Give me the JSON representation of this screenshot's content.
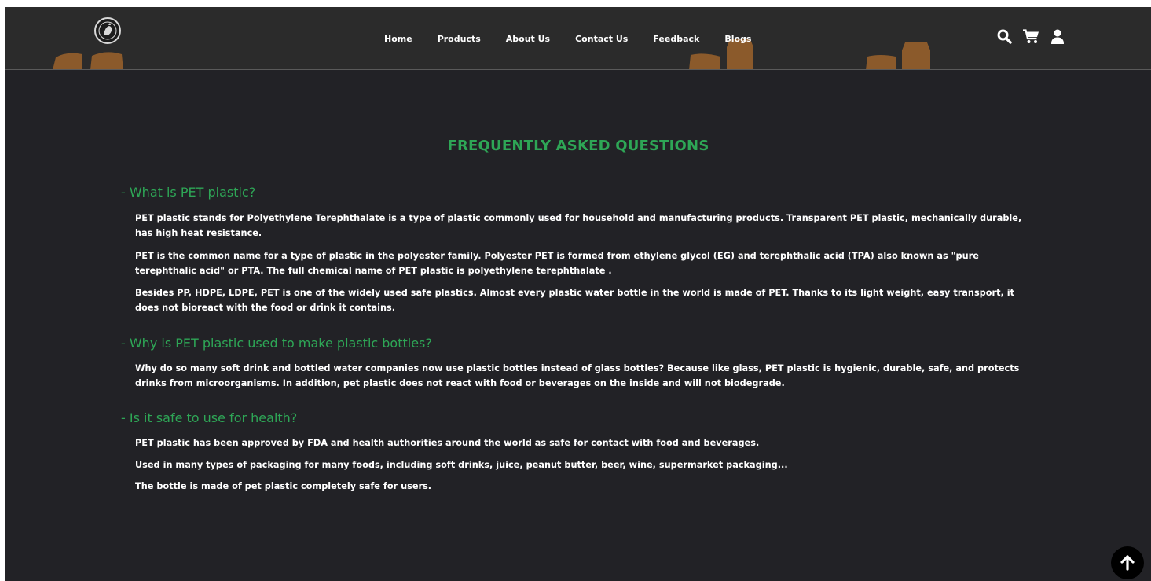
{
  "nav": {
    "items": [
      {
        "label": "Home",
        "name": "nav-home"
      },
      {
        "label": "Products",
        "name": "nav-products"
      },
      {
        "label": "About Us",
        "name": "nav-about-us"
      },
      {
        "label": "Contact Us",
        "name": "nav-contact-us"
      },
      {
        "label": "Feedback",
        "name": "nav-feedback"
      },
      {
        "label": "Blogs",
        "name": "nav-blogs"
      }
    ]
  },
  "header_icons": [
    "search-icon",
    "cart-icon",
    "user-icon"
  ],
  "colors": {
    "accent": "#2ea656",
    "background": "#222226",
    "header": "#2b2b2b",
    "bottle": "#8b5a2b"
  },
  "faq": {
    "title": "FREQUENTLY ASKED QUESTIONS",
    "sections": [
      {
        "question": "- What is PET plastic?",
        "paragraphs": [
          "PET plastic stands for Polyethylene Terephthalate is a type of plastic commonly used for household and manufacturing products. Transparent PET plastic, mechanically durable, has high heat resistance.",
          "PET is the common name for a type of plastic in the polyester family. Polyester PET is formed from ethylene glycol (EG) and terephthalic acid (TPA) also known as \"pure terephthalic acid\" or PTA. The full chemical name of PET plastic is polyethylene terephthalate .",
          "Besides PP, HDPE, LDPE, PET is one of the widely used safe plastics. Almost every plastic water bottle in the world is made of PET. Thanks to its light weight, easy transport, it does not bioreact with the food or drink it contains."
        ]
      },
      {
        "question": "- Why is PET plastic used to make plastic bottles?",
        "paragraphs": [
          "Why do so many soft drink and bottled water companies now use plastic bottles instead of glass bottles? Because like glass, PET plastic is hygienic, durable, safe, and protects drinks from microorganisms. In addition, pet plastic does not react with food or beverages on the inside and will not biodegrade."
        ]
      },
      {
        "question": "- Is it safe to use for health?",
        "paragraphs": [
          "PET plastic has been approved by FDA and health authorities around the world as safe for contact with food and beverages.",
          "Used in many types of packaging for many foods, including soft drinks, juice, peanut butter, beer, wine, supermarket packaging...",
          "The bottle is made of pet plastic completely safe for users."
        ]
      }
    ]
  }
}
